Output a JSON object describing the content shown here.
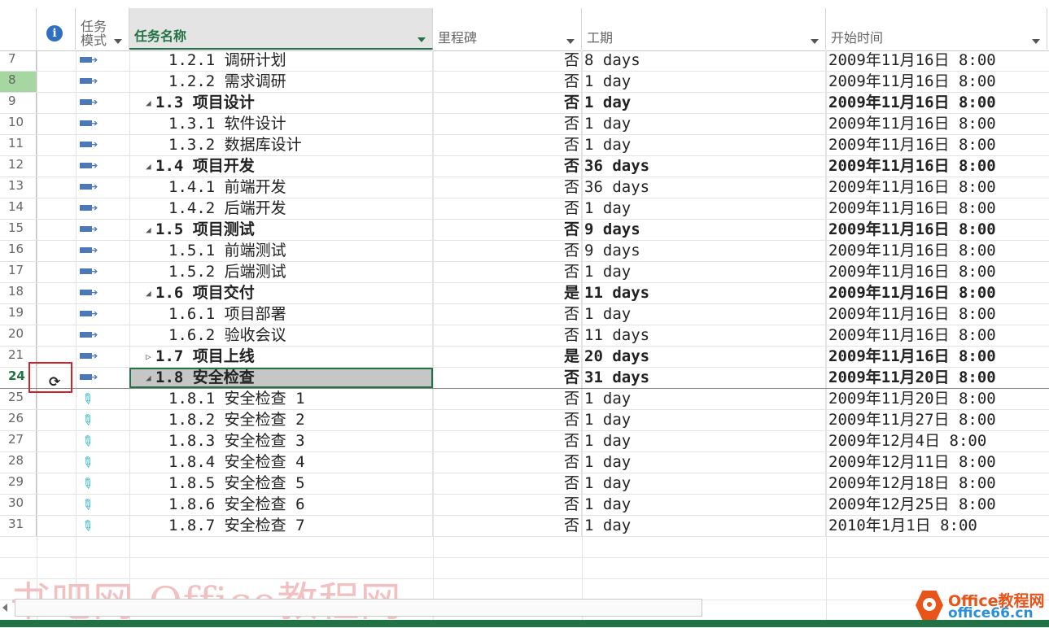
{
  "columns": {
    "indicator_icon": "info-icon",
    "mode_line1": "任务",
    "mode_line2": "模式",
    "name": "任务名称",
    "milestone": "里程碑",
    "duration": "工期",
    "start": "开始时间"
  },
  "rows": [
    {
      "num": "7",
      "name": "1.2.1 调研计划",
      "milestone": "否",
      "duration": "8 days",
      "start": "2009年11月16日 8:00"
    },
    {
      "num": "8",
      "name": "1.2.2 需求调研",
      "milestone": "否",
      "duration": "1 day",
      "start": "2009年11月16日 8:00"
    },
    {
      "num": "9",
      "name": "1.3 项目设计",
      "milestone": "否",
      "duration": "1 day",
      "start": "2009年11月16日 8:00"
    },
    {
      "num": "10",
      "name": "1.3.1 软件设计",
      "milestone": "否",
      "duration": "1 day",
      "start": "2009年11月16日 8:00"
    },
    {
      "num": "11",
      "name": "1.3.2 数据库设计",
      "milestone": "否",
      "duration": "1 day",
      "start": "2009年11月16日 8:00"
    },
    {
      "num": "12",
      "name": "1.4 项目开发",
      "milestone": "否",
      "duration": "36 days",
      "start": "2009年11月16日 8:00"
    },
    {
      "num": "13",
      "name": "1.4.1 前端开发",
      "milestone": "否",
      "duration": "36 days",
      "start": "2009年11月16日 8:00"
    },
    {
      "num": "14",
      "name": "1.4.2 后端开发",
      "milestone": "否",
      "duration": "1 day",
      "start": "2009年11月16日 8:00"
    },
    {
      "num": "15",
      "name": "1.5 项目测试",
      "milestone": "否",
      "duration": "9 days",
      "start": "2009年11月16日 8:00"
    },
    {
      "num": "16",
      "name": "1.5.1 前端测试",
      "milestone": "否",
      "duration": "9 days",
      "start": "2009年11月16日 8:00"
    },
    {
      "num": "17",
      "name": "1.5.2 后端测试",
      "milestone": "否",
      "duration": "1 day",
      "start": "2009年11月16日 8:00"
    },
    {
      "num": "18",
      "name": "1.6 项目交付",
      "milestone": "是",
      "duration": "11 days",
      "start": "2009年11月16日 8:00"
    },
    {
      "num": "19",
      "name": "1.6.1 项目部署",
      "milestone": "否",
      "duration": "1 day",
      "start": "2009年11月16日 8:00"
    },
    {
      "num": "20",
      "name": "1.6.2 验收会议",
      "milestone": "否",
      "duration": "11 days",
      "start": "2009年11月16日 8:00"
    },
    {
      "num": "21",
      "name": "1.7 项目上线",
      "milestone": "是",
      "duration": "20 days",
      "start": "2009年11月16日 8:00"
    },
    {
      "num": "24",
      "name": "1.8 安全检查",
      "milestone": "否",
      "duration": "31 days",
      "start": "2009年11月20日 8:00"
    },
    {
      "num": "25",
      "name": "1.8.1 安全检查 1",
      "milestone": "否",
      "duration": "1 day",
      "start": "2009年11月20日 8:00"
    },
    {
      "num": "26",
      "name": "1.8.2 安全检查 2",
      "milestone": "否",
      "duration": "1 day",
      "start": "2009年11月27日 8:00"
    },
    {
      "num": "27",
      "name": "1.8.3 安全检查 3",
      "milestone": "否",
      "duration": "1 day",
      "start": "2009年12月4日 8:00"
    },
    {
      "num": "28",
      "name": "1.8.4 安全检查 4",
      "milestone": "否",
      "duration": "1 day",
      "start": "2009年12月11日 8:00"
    },
    {
      "num": "29",
      "name": "1.8.5 安全检查 5",
      "milestone": "否",
      "duration": "1 day",
      "start": "2009年12月18日 8:00"
    },
    {
      "num": "30",
      "name": "1.8.6 安全检查 6",
      "milestone": "否",
      "duration": "1 day",
      "start": "2009年12月25日 8:00"
    },
    {
      "num": "31",
      "name": "1.8.7 安全检查 7",
      "milestone": "否",
      "duration": "1 day",
      "start": "2010年1月1日 8:00"
    }
  ],
  "icons": {
    "auto_scheduled": "auto-scheduled-task-icon",
    "manual_scheduled": "manually-scheduled-pin-icon",
    "recurring": "recurring-task-icon",
    "expanded": "expanded-triangle",
    "collapsed": "collapsed-triangle"
  },
  "colors": {
    "accent": "#217346",
    "highlight_row_number": "#a7d7a1",
    "selected_cell": "#c6c6c6",
    "callout_border": "#d2232a",
    "task_bar_icon": "#4a78b8",
    "pin_icon": "#2cb7c0"
  },
  "watermark": "书吧网-Office教程网",
  "logo": {
    "line1": "Office教程网",
    "line2": "office66.cn"
  }
}
